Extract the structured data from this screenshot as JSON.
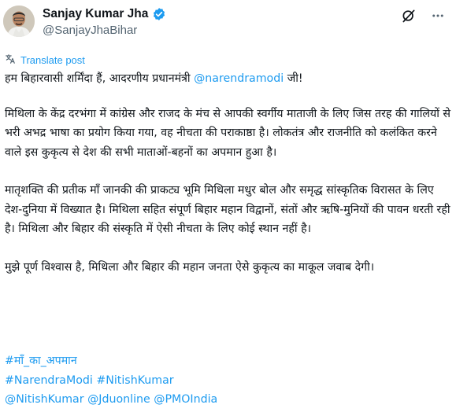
{
  "author": {
    "name": "Sanjay Kumar Jha",
    "handle": "@SanjayJhaBihar",
    "verified_icon": "verified-badge-icon",
    "avatar_icon": "profile-photo"
  },
  "actions": {
    "grok_icon": "grok-icon",
    "more_icon": "more-icon"
  },
  "translate": {
    "label": "Translate post",
    "icon": "translate-icon"
  },
  "tweet": {
    "greeting_prefix": "हम बिहारवासी शर्मिंदा हैं, आदरणीय प्रधानमंत्री ",
    "greeting_mention": "@narendramodi",
    "greeting_suffix": " जी!",
    "para1": "मिथिला के केंद्र दरभंगा में कांग्रेस और राजद के मंच से आपकी स्वर्गीय माताजी के लिए जिस तरह की गालियों से भरी अभद्र भाषा का प्रयोग किया गया, वह नीचता की पराकाष्ठा है। लोकतंत्र और राजनीति को कलंकित करने वाले इस कुकृत्य से देश की सभी माताओं-बहनों का अपमान हुआ है।",
    "para2": "मातृशक्ति की प्रतीक माँ जानकी की प्राकट्य भूमि मिथिला मधुर बोल और समृद्ध सांस्कृतिक विरासत के लिए देश-दुनिया में विख्यात है। मिथिला सहित संपूर्ण बिहार महान विद्वानों, संतों और ऋषि-मुनियों की पावन धरती रही है। मिथिला और बिहार की संस्कृति में ऐसी नीचता के लिए कोई स्थान नहीं है।",
    "para3": "मुझे पूर्ण विश्वास है, मिथिला और बिहार की महान जनता ऐसे कुकृत्य का माकूल जवाब देगी।"
  },
  "tags": {
    "hashtag1": "#माँ_का_अपमान",
    "hashtag2": "#NarendraModi",
    "hashtag3": "#NitishKumar",
    "mention1": "@NitishKumar",
    "mention2": "@Jduonline",
    "mention3": "@PMOIndia"
  },
  "colors": {
    "link": "#1d9bf0",
    "secondary_text": "#536471",
    "primary_text": "#0f1419"
  }
}
